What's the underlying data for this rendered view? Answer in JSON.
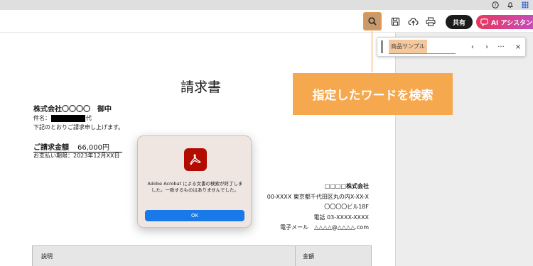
{
  "toolbar": {
    "share_label": "共有",
    "ai_label": "AI アシスタント"
  },
  "find_bar": {
    "query": "商品サンプル",
    "prev_glyph": "‹",
    "next_glyph": "›",
    "more_glyph": "···",
    "close_glyph": "×"
  },
  "callout": {
    "text": "指定したワードを検索"
  },
  "document": {
    "title": "請求書",
    "addressee": "株式会社〇〇〇〇　御中",
    "subject_prefix": "件名：",
    "subject_suffix": "代",
    "intro": "下記のとおりご請求申し上げます。",
    "amount_label": "ご請求金額",
    "amount_value": "66,000円",
    "due": "お支払い期限：2023年12月XX日",
    "issuer": {
      "name": "□□□□株式会社",
      "address1": "00-XXXX 東京都千代田区丸の内X-XX-X",
      "address2": "〇〇〇〇ビル18F",
      "phone": "電話 03-XXXX-XXXX",
      "email": "電子メール　△△△△@△△△△.com"
    },
    "table_headers": [
      "説明",
      "金額"
    ]
  },
  "dialog": {
    "message": "Adobe Acrobat による文書の検索が終了しました。一致するものはありませんでした。",
    "ok_label": "OK"
  }
}
